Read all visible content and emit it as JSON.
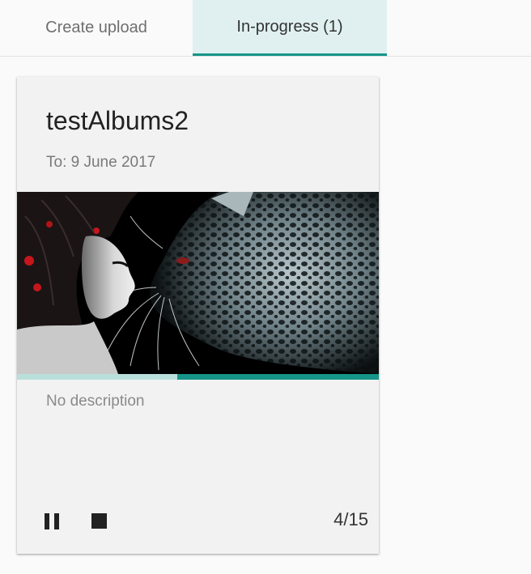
{
  "tabs": {
    "create_label": "Create upload",
    "progress_label": "In-progress (1)"
  },
  "card": {
    "title": "testAlbums2",
    "date": "To: 9 June 2017",
    "description": "No description",
    "counter": "4/15",
    "progress_fraction": 0.4433,
    "pause_icon": "pause-icon",
    "stop_icon": "stop-icon",
    "thumbnail": "woman-and-leopard-image"
  },
  "colors": {
    "accent": "#159588",
    "accent_light": "#b9dfdb",
    "active_tab_bg": "#e0f0f0"
  }
}
